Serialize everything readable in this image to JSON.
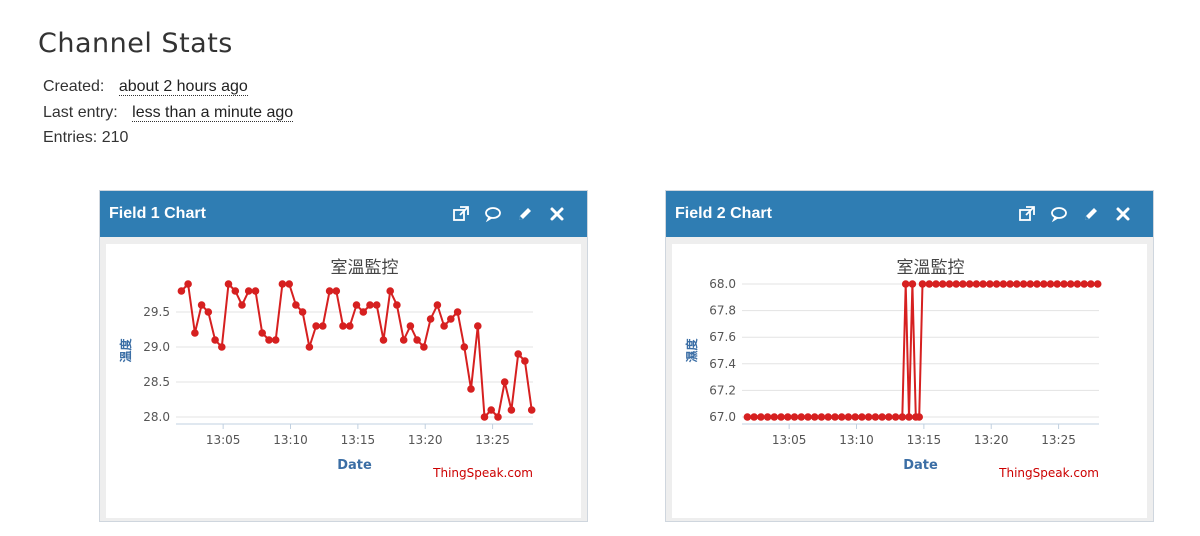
{
  "page": {
    "title": "Channel Stats",
    "created_label": "Created:",
    "created_value": "about 2 hours ago",
    "last_entry_label": "Last entry:",
    "last_entry_value": "less than a minute ago",
    "entries_label": "Entries:",
    "entries_value": "210"
  },
  "colors": {
    "header": "#2f7db3",
    "series": "#d62020",
    "credit": "#cc0000"
  },
  "panels": [
    {
      "title": "Field 1 Chart",
      "icons": [
        "external-window-icon",
        "comment-icon",
        "pencil-icon",
        "close-icon"
      ]
    },
    {
      "title": "Field 2 Chart",
      "icons": [
        "external-window-icon",
        "comment-icon",
        "pencil-icon",
        "close-icon"
      ]
    }
  ],
  "chart_data": [
    {
      "type": "line",
      "title": "室溫監控",
      "xlabel": "Date",
      "ylabel": "溫度",
      "credit": "ThingSpeak.com",
      "x_domain": [
        "13:01:30",
        "13:28:00"
      ],
      "x_ticks": [
        "13:05",
        "13:10",
        "13:15",
        "13:20",
        "13:25"
      ],
      "y_ticks": [
        "28.0",
        "28.5",
        "29.0",
        "29.5"
      ],
      "ylim": [
        28.0,
        29.9
      ],
      "grid": true,
      "series": [
        {
          "x": [
            "13:01:54",
            "13:02:24",
            "13:02:54",
            "13:03:24",
            "13:03:54",
            "13:04:24",
            "13:04:54",
            "13:05:24",
            "13:05:54",
            "13:06:24",
            "13:06:54",
            "13:07:24",
            "13:07:54",
            "13:08:24",
            "13:08:54",
            "13:09:24",
            "13:09:54",
            "13:10:24",
            "13:10:54",
            "13:11:24",
            "13:11:54",
            "13:12:24",
            "13:12:54",
            "13:13:24",
            "13:13:54",
            "13:14:24",
            "13:14:54",
            "13:15:24",
            "13:15:54",
            "13:16:24",
            "13:16:54",
            "13:17:24",
            "13:17:54",
            "13:18:24",
            "13:18:54",
            "13:19:24",
            "13:19:54",
            "13:20:24",
            "13:20:54",
            "13:21:24",
            "13:21:54",
            "13:22:24",
            "13:22:54",
            "13:23:24",
            "13:23:54",
            "13:24:24",
            "13:24:54",
            "13:25:24",
            "13:25:54",
            "13:26:24",
            "13:26:54",
            "13:27:24",
            "13:27:54"
          ],
          "y": [
            29.8,
            29.9,
            29.2,
            29.6,
            29.5,
            29.1,
            29.0,
            29.9,
            29.8,
            29.6,
            29.8,
            29.8,
            29.2,
            29.1,
            29.1,
            29.9,
            29.9,
            29.6,
            29.5,
            29.0,
            29.3,
            29.3,
            29.8,
            29.8,
            29.3,
            29.3,
            29.6,
            29.5,
            29.6,
            29.6,
            29.1,
            29.8,
            29.6,
            29.1,
            29.3,
            29.1,
            29.0,
            29.4,
            29.6,
            29.3,
            29.4,
            29.5,
            29.0,
            28.4,
            29.3,
            28.0,
            28.1,
            28.0,
            28.5,
            28.1,
            28.9,
            28.8,
            28.1
          ]
        }
      ]
    },
    {
      "type": "line",
      "title": "室溫監控",
      "xlabel": "Date",
      "ylabel": "濕度",
      "credit": "ThingSpeak.com",
      "x_domain": [
        "13:01:30",
        "13:28:00"
      ],
      "x_ticks": [
        "13:05",
        "13:10",
        "13:15",
        "13:20",
        "13:25"
      ],
      "y_ticks": [
        "67.0",
        "67.2",
        "67.4",
        "67.6",
        "67.8",
        "68.0"
      ],
      "ylim": [
        67.0,
        68.0
      ],
      "grid": true,
      "series": [
        {
          "x": [
            "13:01:54",
            "13:02:24",
            "13:02:54",
            "13:03:24",
            "13:03:54",
            "13:04:24",
            "13:04:54",
            "13:05:24",
            "13:05:54",
            "13:06:24",
            "13:06:54",
            "13:07:24",
            "13:07:54",
            "13:08:24",
            "13:08:54",
            "13:09:24",
            "13:09:54",
            "13:10:24",
            "13:10:54",
            "13:11:24",
            "13:11:54",
            "13:12:24",
            "13:12:54",
            "13:13:24",
            "13:13:39",
            "13:13:54",
            "13:14:09",
            "13:14:24",
            "13:14:39",
            "13:14:54",
            "13:15:24",
            "13:15:54",
            "13:16:24",
            "13:16:54",
            "13:17:24",
            "13:17:54",
            "13:18:24",
            "13:18:54",
            "13:19:24",
            "13:19:54",
            "13:20:24",
            "13:20:54",
            "13:21:24",
            "13:21:54",
            "13:22:24",
            "13:22:54",
            "13:23:24",
            "13:23:54",
            "13:24:24",
            "13:24:54",
            "13:25:24",
            "13:25:54",
            "13:26:24",
            "13:26:54",
            "13:27:24",
            "13:27:54"
          ],
          "y": [
            67.0,
            67.0,
            67.0,
            67.0,
            67.0,
            67.0,
            67.0,
            67.0,
            67.0,
            67.0,
            67.0,
            67.0,
            67.0,
            67.0,
            67.0,
            67.0,
            67.0,
            67.0,
            67.0,
            67.0,
            67.0,
            67.0,
            67.0,
            67.0,
            68.0,
            67.0,
            68.0,
            67.0,
            67.0,
            68.0,
            68.0,
            68.0,
            68.0,
            68.0,
            68.0,
            68.0,
            68.0,
            68.0,
            68.0,
            68.0,
            68.0,
            68.0,
            68.0,
            68.0,
            68.0,
            68.0,
            68.0,
            68.0,
            68.0,
            68.0,
            68.0,
            68.0,
            68.0,
            68.0,
            68.0,
            68.0
          ]
        }
      ]
    }
  ]
}
